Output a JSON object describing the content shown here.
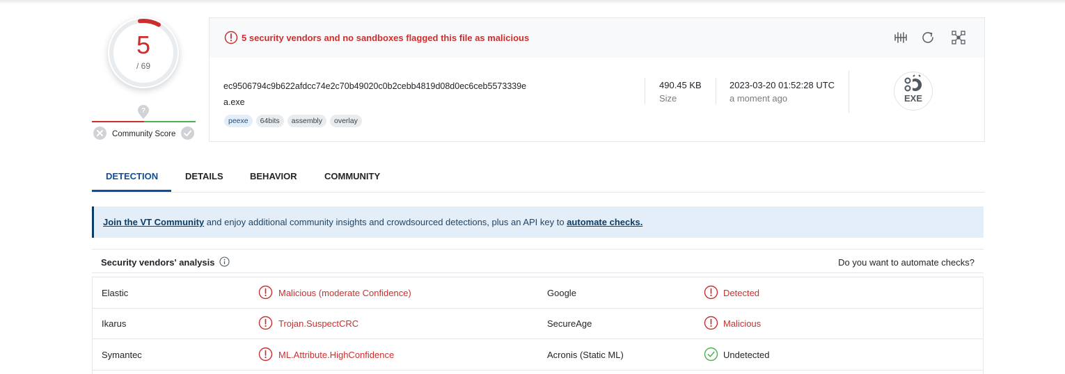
{
  "score": {
    "detections": "5",
    "total": "/ 69"
  },
  "community": {
    "label": "Community Score"
  },
  "alert": {
    "text": "5 security vendors and no sandboxes flagged this file as malicious"
  },
  "file": {
    "hash": "ec9506794c9b622afdcc74e2c70b49020c0b2cebb4819d08d0ec6ceb5573339e",
    "name": "a.exe",
    "tags": [
      "peexe",
      "64bits",
      "assembly",
      "overlay"
    ],
    "size_value": "490.45 KB",
    "size_label": "Size",
    "date_value": "2023-03-20 01:52:28 UTC",
    "date_label": "a moment ago",
    "type_icon_label": "EXE"
  },
  "tabs": [
    {
      "label": "DETECTION",
      "active": true
    },
    {
      "label": "DETAILS"
    },
    {
      "label": "BEHAVIOR"
    },
    {
      "label": "COMMUNITY"
    }
  ],
  "banner": {
    "link1": "Join the VT Community",
    "middle": " and enjoy additional community insights and crowdsourced detections, plus an API key to ",
    "link2": "automate checks."
  },
  "vendors": {
    "title": "Security vendors' analysis",
    "automate_question": "Do you want to automate checks?",
    "rows": [
      {
        "left_name": "Elastic",
        "left_result": "Malicious (moderate Confidence)",
        "left_status": "malicious",
        "right_name": "Google",
        "right_result": "Detected",
        "right_status": "malicious"
      },
      {
        "left_name": "Ikarus",
        "left_result": "Trojan.SuspectCRC",
        "left_status": "malicious",
        "right_name": "SecureAge",
        "right_result": "Malicious",
        "right_status": "malicious"
      },
      {
        "left_name": "Symantec",
        "left_result": "ML.Attribute.HighConfidence",
        "left_status": "malicious",
        "right_name": "Acronis (Static ML)",
        "right_result": "Undetected",
        "right_status": "undetected"
      }
    ]
  },
  "colors": {
    "malicious": "#cc2e2e",
    "clean": "#4caf50",
    "accent": "#0b4ea2"
  }
}
